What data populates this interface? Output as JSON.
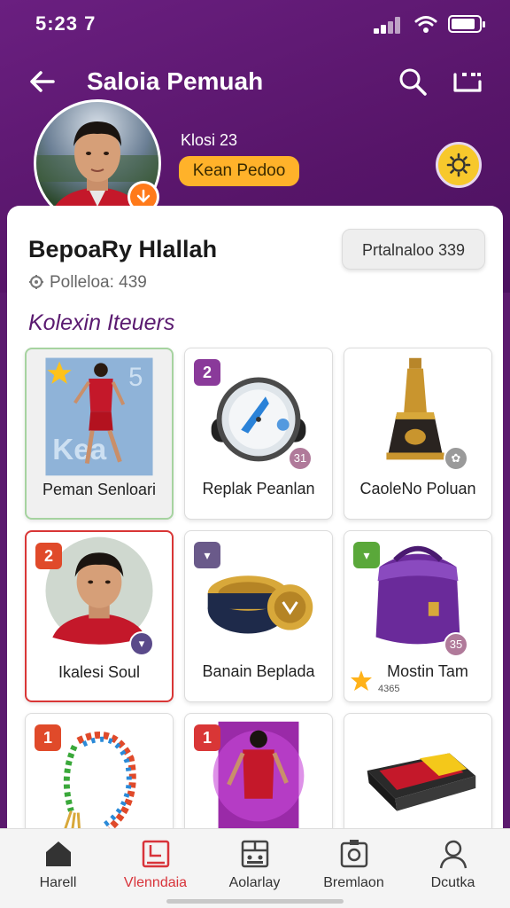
{
  "status": {
    "time": "5:23 7"
  },
  "header": {
    "title": "Saloia Pemuah"
  },
  "profile": {
    "level": "Klosi 23",
    "rank": "Kean Pedoo",
    "name": "BepoaRy Hlallah",
    "points": "Polleloa: 439",
    "points_button": "Prtalnaloo 339"
  },
  "collection": {
    "title": "Kolexin Iteuers",
    "items": [
      {
        "label": "Peman Senloari",
        "badge": "star"
      },
      {
        "label": "Replak Peanlan",
        "badge": "2",
        "count": "31"
      },
      {
        "label": "CaoleNo Poluan",
        "count": "flower"
      },
      {
        "label": "Ikalesi Soul",
        "badge": "2"
      },
      {
        "label": "Banain Beplada"
      },
      {
        "label": "Mostin Tam",
        "count": "35",
        "sub": "4365"
      },
      {
        "label": "",
        "badge": "1"
      },
      {
        "label": "",
        "badge": "1"
      },
      {
        "label": ""
      }
    ]
  },
  "nav": {
    "items": [
      {
        "label": "Harell",
        "icon": "home-icon"
      },
      {
        "label": "Vlenndaia",
        "icon": "bookmark-icon"
      },
      {
        "label": "Aolarlay",
        "icon": "gallery-icon"
      },
      {
        "label": "Bremlaon",
        "icon": "camera-icon"
      },
      {
        "label": "Dcutka",
        "icon": "profile-icon"
      }
    ],
    "active_index": 1
  },
  "colors": {
    "primary": "#5b1a6e",
    "accent": "#ffb22a",
    "active": "#d8333a"
  }
}
